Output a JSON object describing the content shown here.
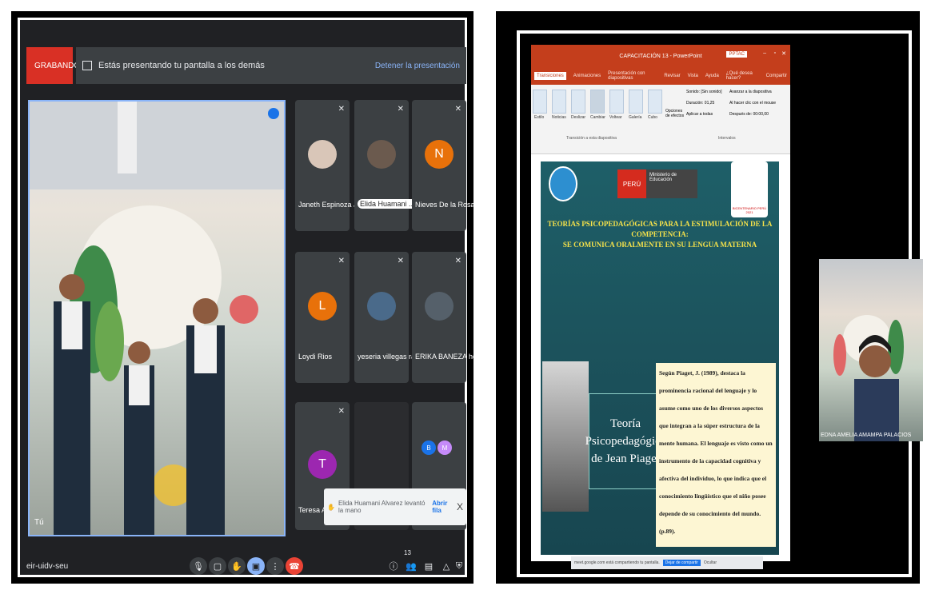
{
  "meet": {
    "recording_label": "GRABANDO",
    "presenting_text": "Estás presentando tu pantalla a los demás",
    "stop_presenting": "Detener la presentación",
    "main_name": "Tú",
    "participants": [
      {
        "name": "Janeth Espinoza Ja...",
        "avatar": "photo"
      },
      {
        "name": "Elida Huamani ...",
        "avatar": "photo"
      },
      {
        "name": "Nieves De la Rosa",
        "avatar": "N",
        "color": "#e8710a"
      },
      {
        "name": "Loydi Rios",
        "avatar": "L",
        "color": "#e8710a"
      },
      {
        "name": "yeseria villegas ra...",
        "avatar": "photo"
      },
      {
        "name": "ERIKA BANEZA her...",
        "avatar": "photo"
      },
      {
        "name": "Teresa Alci...",
        "avatar": "T",
        "color": "#9c27b0"
      },
      {
        "name": "",
        "avatar": "screen"
      },
      {
        "name": "",
        "avatar": "BM"
      }
    ],
    "notification": {
      "text": "Elida Huamani Alvarez levantó la mano",
      "action": "Abrir fila",
      "close": "X"
    },
    "meeting_code": "eir-uidv-seu",
    "participant_count": "13"
  },
  "ppt": {
    "window_title": "CAPACITACIÓN 13 - PowerPoint",
    "tabs": [
      "Transiciones",
      "Animaciones",
      "Presentación con diapositivas",
      "Revisar",
      "Vista",
      "Ayuda",
      "¿Qué desea hacer?",
      "Compartir"
    ],
    "ribbon_buttons": [
      "Estilo",
      "Noticias",
      "Deslizar",
      "Cambiar",
      "Voltear",
      "Galería",
      "Cubo"
    ],
    "ribbon_section": "Transición a esta diapositiva",
    "timing_label": "Intervalos",
    "sound": "Sonido: [Sin sonido]",
    "duration": "Duración: 01,25",
    "apply_all": "Aplicar a todas",
    "advance": "Avanzar a la diapositiva",
    "on_click": "Al hacer clic con el mouse",
    "after": "Después de: 00:00,00",
    "effect_options": "Opciones de efectos",
    "slide": {
      "ministry_line1": "PERÚ",
      "ministry_line2": "Ministerio de Educación",
      "bicentenario": "BICENTENARIO PERÚ 2021",
      "title_line1": "TEORÍAS PSICOPEDAGÓGICAS PARA LA ESTIMULACIÓN DE LA COMPETENCIA:",
      "title_line2": "SE COMUNICA ORALMENTE EN SU LENGUA MATERNA",
      "box_text": "Teoría Psicopedagógica de Jean Piaget",
      "quote": "Según Piaget, J. (1989), destaca la prominencia racional del lenguaje y lo asume como uno de los diversos aspectos que integran a la súper estructura de la mente humana. El lenguaje es visto como un instrumento de la capacidad cognitiva y afectiva del individuo, lo que indica que el conocimiento lingüístico que el niño posee depende de su conocimiento del mundo. (p.89)."
    },
    "status": {
      "text": "meet.google.com está compartiendo tu pantalla.",
      "share": "Dejar de compartir",
      "hide": "Ocultar"
    }
  },
  "camera": {
    "name": "EDNA AMELIA AMAMPA PALACIOS"
  }
}
